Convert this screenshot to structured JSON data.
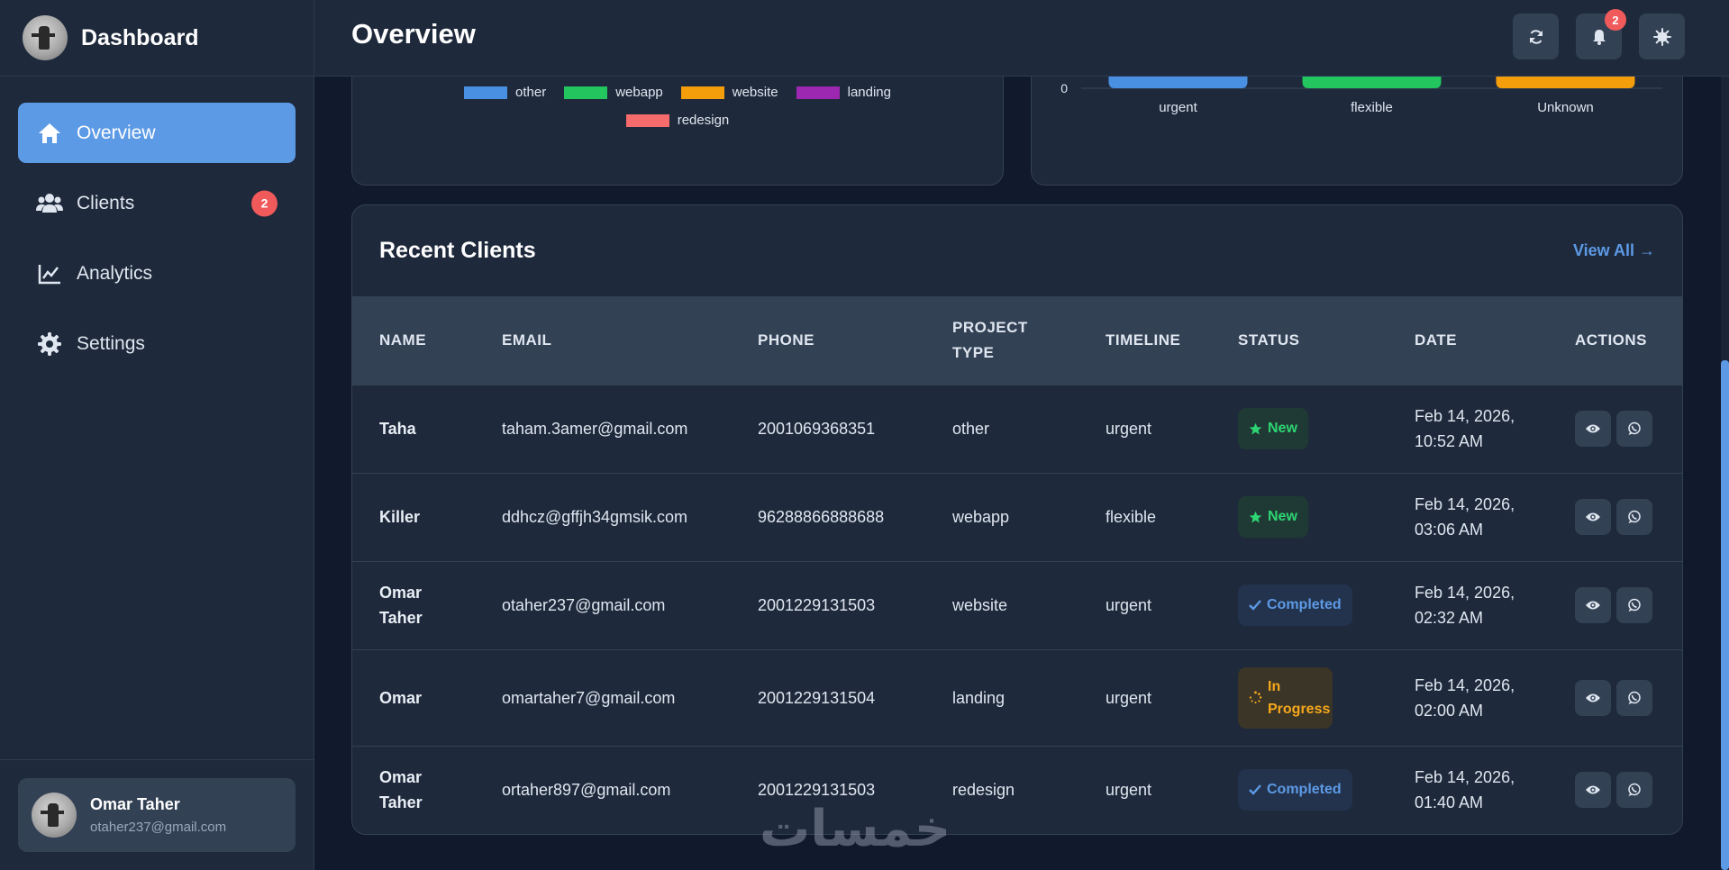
{
  "sidebar": {
    "brand": "Dashboard",
    "items": [
      {
        "label": "Overview",
        "icon": "home-icon",
        "active": true
      },
      {
        "label": "Clients",
        "icon": "users-icon",
        "badge": "2"
      },
      {
        "label": "Analytics",
        "icon": "chart-line-icon"
      },
      {
        "label": "Settings",
        "icon": "gear-icon"
      }
    ],
    "user": {
      "name": "Omar Taher",
      "email": "otaher237@gmail.com"
    }
  },
  "header": {
    "title": "Overview",
    "notification_count": "2",
    "buttons": [
      "refresh-icon",
      "bell-icon",
      "sun-icon"
    ]
  },
  "colors": {
    "accent": "#5d9ae6",
    "badge": "#f05a5a",
    "new": "#2ed573",
    "progress": "#f7a81b"
  },
  "chart_data": [
    {
      "type": "pie",
      "legend": [
        "other",
        "webapp",
        "website",
        "landing",
        "redesign"
      ],
      "colors": [
        "#4a90e2",
        "#22c55e",
        "#f59e0b",
        "#9c27b0",
        "#f66b6b"
      ]
    },
    {
      "type": "bar",
      "categories": [
        "urgent",
        "flexible",
        "Unknown"
      ],
      "colors": [
        "#4a90e2",
        "#22c55e",
        "#f59e0b"
      ],
      "y_ticks": [
        "0"
      ]
    }
  ],
  "clients": {
    "title": "Recent Clients",
    "view_all": "View All →",
    "columns": [
      "NAME",
      "EMAIL",
      "PHONE",
      "PROJECT TYPE",
      "TIMELINE",
      "STATUS",
      "DATE",
      "ACTIONS"
    ],
    "rows": [
      {
        "name": "Taha",
        "email": "taham.3amer@gmail.com",
        "phone": "2001069368351",
        "project": "other",
        "timeline": "urgent",
        "status": "New",
        "status_type": "new",
        "date": "Feb 14, 2026, 10:52 AM"
      },
      {
        "name": "Killer",
        "email": "ddhcz@gffjh34gmsik.com",
        "phone": "96288866888688",
        "project": "webapp",
        "timeline": "flexible",
        "status": "New",
        "status_type": "new",
        "date": "Feb 14, 2026, 03:06 AM"
      },
      {
        "name": "Omar Taher",
        "email": "otaher237@gmail.com",
        "phone": "2001229131503",
        "project": "website",
        "timeline": "urgent",
        "status": "Completed",
        "status_type": "completed",
        "date": "Feb 14, 2026, 02:32 AM"
      },
      {
        "name": "Omar",
        "email": "omartaher7@gmail.com",
        "phone": "2001229131504",
        "project": "landing",
        "timeline": "urgent",
        "status": "In Progress",
        "status_type": "progress",
        "date": "Feb 14, 2026, 02:00 AM"
      },
      {
        "name": "Omar Taher",
        "email": "ortaher897@gmail.com",
        "phone": "2001229131503",
        "project": "redesign",
        "timeline": "urgent",
        "status": "Completed",
        "status_type": "completed",
        "date": "Feb 14, 2026, 01:40 AM"
      }
    ]
  },
  "watermark": "خمسات"
}
